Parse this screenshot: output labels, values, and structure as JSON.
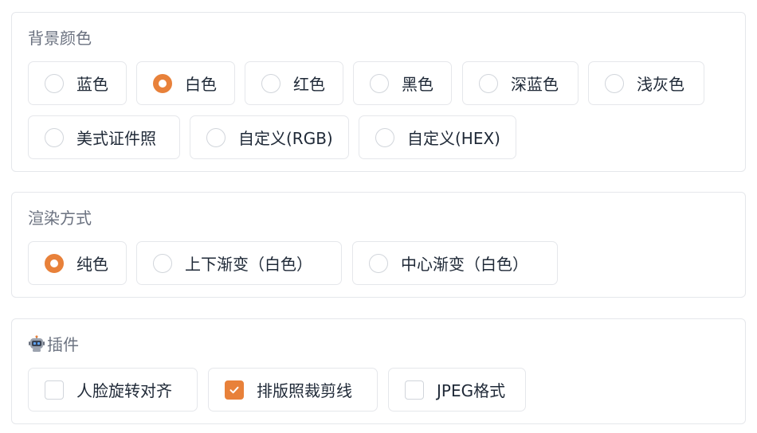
{
  "background_color": {
    "title": "背景颜色",
    "options": [
      {
        "label": "蓝色",
        "checked": false
      },
      {
        "label": "白色",
        "checked": true
      },
      {
        "label": "红色",
        "checked": false
      },
      {
        "label": "黑色",
        "checked": false
      },
      {
        "label": "深蓝色",
        "checked": false
      },
      {
        "label": "浅灰色",
        "checked": false
      },
      {
        "label": "美式证件照",
        "checked": false
      },
      {
        "label": "自定义(RGB)",
        "checked": false
      },
      {
        "label": "自定义(HEX)",
        "checked": false
      }
    ]
  },
  "render_mode": {
    "title": "渲染方式",
    "options": [
      {
        "label": "纯色",
        "checked": true
      },
      {
        "label": "上下渐变（白色）",
        "checked": false
      },
      {
        "label": "中心渐变（白色）",
        "checked": false
      }
    ]
  },
  "plugins": {
    "icon": "robot-icon",
    "title": "插件",
    "options": [
      {
        "label": "人脸旋转对齐",
        "checked": false
      },
      {
        "label": "排版照裁剪线",
        "checked": true
      },
      {
        "label": "JPEG格式",
        "checked": false
      }
    ]
  },
  "colors": {
    "accent": "#e8813a",
    "border": "#e5e7eb",
    "title_text": "#6b7280",
    "text": "#1f2937"
  }
}
